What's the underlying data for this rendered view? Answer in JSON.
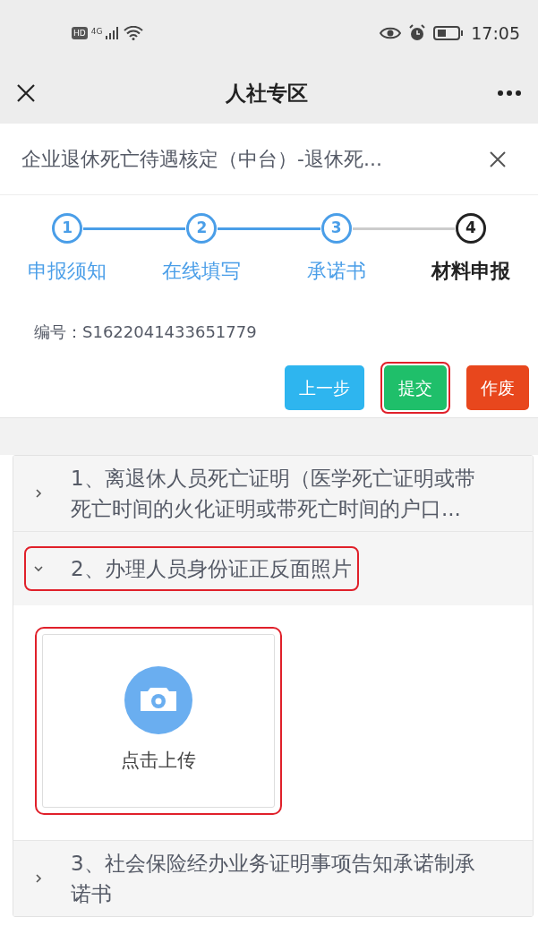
{
  "status_bar": {
    "time": "17:05",
    "network": "4G",
    "hd_badge": "HD"
  },
  "nav": {
    "title": "人社专区"
  },
  "header": {
    "title": "企业退休死亡待遇核定（中台）-退休死..."
  },
  "steps": [
    {
      "number": "1",
      "label": "申报须知",
      "done": true,
      "selected": false
    },
    {
      "number": "2",
      "label": "在线填写",
      "done": true,
      "selected": false
    },
    {
      "number": "3",
      "label": "承诺书",
      "done": true,
      "selected": false
    },
    {
      "number": "4",
      "label": "材料申报",
      "done": false,
      "selected": true
    }
  ],
  "serial": {
    "label": "编号：",
    "value": "S1622041433651779"
  },
  "buttons": [
    {
      "label": "上一步",
      "kind": "back",
      "highlighted": false
    },
    {
      "label": "提交",
      "kind": "submit",
      "highlighted": true
    },
    {
      "label": "作废",
      "kind": "void",
      "highlighted": false
    }
  ],
  "materials": [
    {
      "title": "1、离退休人员死亡证明（医学死亡证明或带死亡时间的火化证明或带死亡时间的户口...",
      "expanded": false,
      "highlighted": false
    },
    {
      "title": "2、办理人员身份证正反面照片",
      "expanded": true,
      "highlighted": true,
      "upload": {
        "label": "点击上传",
        "highlighted": true
      }
    },
    {
      "title": "3、社会保险经办业务证明事项告知承诺制承诺书",
      "expanded": false,
      "highlighted": false
    }
  ]
}
